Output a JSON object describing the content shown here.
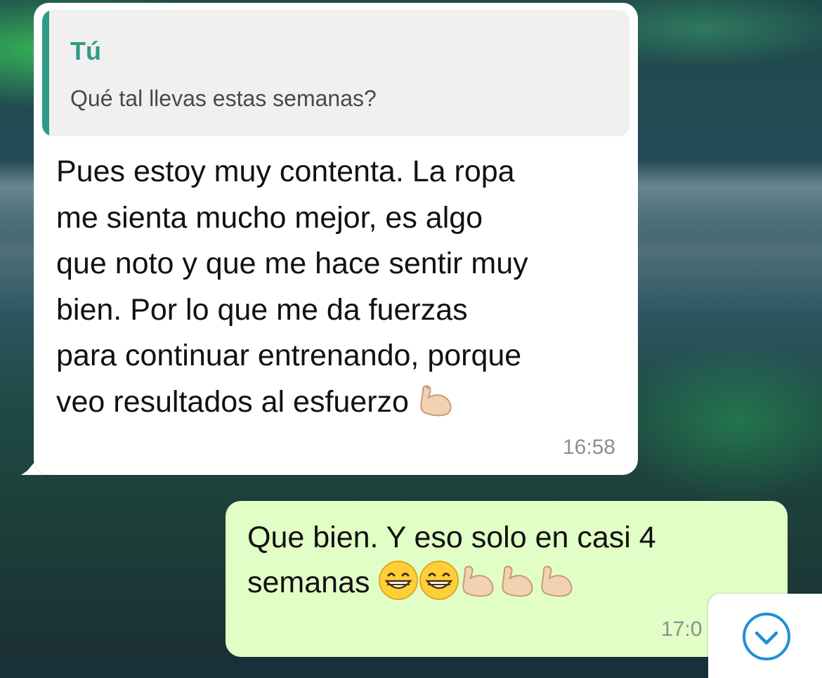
{
  "chat": {
    "incoming": {
      "quote": {
        "author": "Tú",
        "text": "Qué tal llevas estas semanas?"
      },
      "lines": [
        "Pues estoy muy contenta. La ropa",
        "me sienta mucho mejor, es algo",
        "que noto y que me hace sentir muy",
        "bien. Por lo que me da fuerzas",
        "para continuar entrenando, porque",
        "veo resultados al esfuerzo"
      ],
      "emoji": "flexed-biceps-emoji",
      "time": "16:58"
    },
    "outgoing": {
      "lines": [
        "Que bien. Y eso solo en casi 4",
        "semanas"
      ],
      "emojis": [
        "grinning-face-emoji",
        "grinning-face-emoji",
        "flexed-biceps-emoji",
        "flexed-biceps-emoji",
        "flexed-biceps-emoji"
      ],
      "time": "17:0"
    }
  },
  "scroll_button": {
    "icon": "chevron-down-icon",
    "accent": "#1f8fd6"
  },
  "colors": {
    "incoming_bubble": "#ffffff",
    "outgoing_bubble": "#e1fec6",
    "quote_accent": "#2e9b86",
    "timestamp": "#8a9093"
  }
}
